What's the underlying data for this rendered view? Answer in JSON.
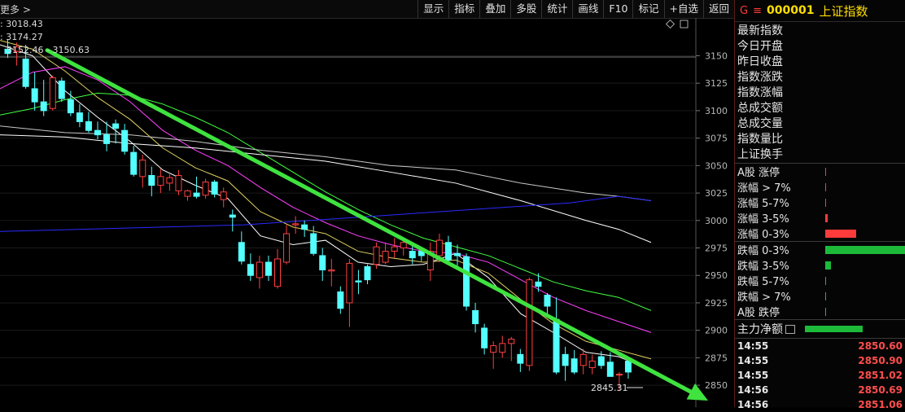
{
  "toolbar": {
    "more_label": "更多 >",
    "buttons": [
      "显示",
      "指标",
      "叠加",
      "多股",
      "统计",
      "画线",
      "F10",
      "标记",
      "+自选",
      "返回"
    ]
  },
  "chart_info": {
    "line1": ": 3018.43",
    "line2": ": 3174.27",
    "range_label": "3152.46 - 3150.63",
    "low_label": "2845.31"
  },
  "chart_icons": [
    "diamond-icon",
    "window-icon"
  ],
  "chart_data": {
    "type": "candlestick",
    "y_ticks": [
      "3150",
      "3125",
      "3100",
      "3075",
      "3050",
      "3025",
      "3000",
      "2975",
      "2950",
      "2925",
      "2900",
      "2875",
      "2850"
    ],
    "ylim": [
      2836,
      3180
    ],
    "candles": [
      [
        3156,
        3165,
        3148,
        3152
      ],
      [
        3154,
        3162,
        3141,
        3158
      ],
      [
        3147,
        3160,
        3120,
        3122
      ],
      [
        3120,
        3135,
        3100,
        3108
      ],
      [
        3108,
        3128,
        3095,
        3100
      ],
      [
        3102,
        3132,
        3100,
        3130
      ],
      [
        3127,
        3130,
        3108,
        3111
      ],
      [
        3110,
        3118,
        3095,
        3098
      ],
      [
        3098,
        3106,
        3085,
        3090
      ],
      [
        3090,
        3099,
        3080,
        3082
      ],
      [
        3082,
        3090,
        3074,
        3078
      ],
      [
        3078,
        3090,
        3063,
        3070
      ],
      [
        3088,
        3092,
        3070,
        3084
      ],
      [
        3082,
        3088,
        3060,
        3063
      ],
      [
        3062,
        3068,
        3040,
        3042
      ],
      [
        3040,
        3060,
        3030,
        3055
      ],
      [
        3041,
        3049,
        3022,
        3032
      ],
      [
        3032,
        3047,
        3025,
        3040
      ],
      [
        3034,
        3042,
        3027,
        3039
      ],
      [
        3027,
        3046,
        3023,
        3041
      ],
      [
        3022,
        3028,
        3018,
        3027
      ],
      [
        3025,
        3040,
        3020,
        3022
      ],
      [
        3023,
        3038,
        3020,
        3035
      ],
      [
        3035,
        3037,
        3021,
        3024
      ],
      [
        3019,
        3030,
        3012,
        3026
      ],
      [
        3005,
        3010,
        2990,
        3003
      ],
      [
        2980,
        2990,
        2960,
        2963
      ],
      [
        2960,
        2970,
        2945,
        2950
      ],
      [
        2948,
        2968,
        2938,
        2962
      ],
      [
        2962,
        2968,
        2945,
        2950
      ],
      [
        2940,
        2974,
        2938,
        2965
      ],
      [
        2962,
        2996,
        2960,
        2988
      ],
      [
        2996,
        3004,
        2988,
        2997
      ],
      [
        2996,
        3000,
        2985,
        2992
      ],
      [
        2988,
        2995,
        2968,
        2970
      ],
      [
        2968,
        2975,
        2945,
        2955
      ],
      [
        2954,
        2965,
        2940,
        2955
      ],
      [
        2935,
        2940,
        2915,
        2920
      ],
      [
        2925,
        2965,
        2903,
        2961
      ],
      [
        2945,
        2955,
        2933,
        2944
      ],
      [
        2958,
        2960,
        2942,
        2946
      ],
      [
        2960,
        2980,
        2956,
        2976
      ],
      [
        2962,
        2980,
        2960,
        2972
      ],
      [
        2972,
        2984,
        2966,
        2976
      ],
      [
        2975,
        2983,
        2968,
        2980
      ],
      [
        2972,
        2978,
        2960,
        2966
      ],
      [
        2972,
        2976,
        2963,
        2968
      ],
      [
        2955,
        2980,
        2945,
        2972
      ],
      [
        2968,
        2988,
        2962,
        2982
      ],
      [
        2980,
        2986,
        2960,
        2964
      ],
      [
        2970,
        2978,
        2955,
        2968
      ],
      [
        2967,
        2970,
        2918,
        2922
      ],
      [
        2918,
        2925,
        2898,
        2906
      ],
      [
        2902,
        2906,
        2878,
        2884
      ],
      [
        2880,
        2890,
        2865,
        2886
      ],
      [
        2880,
        2895,
        2875,
        2888
      ],
      [
        2888,
        2894,
        2872,
        2892
      ],
      [
        2878,
        2883,
        2862,
        2870
      ],
      [
        2868,
        2948,
        2863,
        2946
      ],
      [
        2944,
        2952,
        2935,
        2940
      ],
      [
        2932,
        2934,
        2915,
        2922
      ],
      [
        2910,
        2930,
        2860,
        2862
      ],
      [
        2878,
        2885,
        2854,
        2868
      ],
      [
        2874,
        2882,
        2860,
        2862
      ],
      [
        2868,
        2883,
        2860,
        2878
      ],
      [
        2866,
        2878,
        2860,
        2872
      ],
      [
        2876,
        2881,
        2865,
        2868
      ],
      [
        2871,
        2880,
        2860,
        2858
      ],
      [
        2860,
        2862,
        2845,
        2860
      ],
      [
        2872,
        2874,
        2856,
        2862
      ]
    ],
    "ma_series": [
      {
        "color": "#ffffff",
        "pts": [
          [
            0,
            3160
          ],
          [
            40,
            3150
          ],
          [
            80,
            3118
          ],
          [
            120,
            3094
          ],
          [
            160,
            3072
          ],
          [
            200,
            3046
          ],
          [
            240,
            3032
          ],
          [
            280,
            3020
          ],
          [
            320,
            2986
          ],
          [
            360,
            2978
          ],
          [
            400,
            2982
          ],
          [
            440,
            2962
          ],
          [
            480,
            2958
          ],
          [
            520,
            2960
          ],
          [
            560,
            2970
          ],
          [
            600,
            2948
          ],
          [
            640,
            2915
          ],
          [
            680,
            2898
          ],
          [
            720,
            2880
          ],
          [
            760,
            2876
          ],
          [
            800,
            2864
          ]
        ]
      },
      {
        "color": "#e0d060",
        "pts": [
          [
            0,
            3164
          ],
          [
            40,
            3156
          ],
          [
            80,
            3136
          ],
          [
            120,
            3112
          ],
          [
            160,
            3092
          ],
          [
            200,
            3066
          ],
          [
            240,
            3048
          ],
          [
            280,
            3036
          ],
          [
            320,
            3008
          ],
          [
            360,
            2994
          ],
          [
            400,
            2988
          ],
          [
            440,
            2972
          ],
          [
            480,
            2966
          ],
          [
            520,
            2962
          ],
          [
            560,
            2964
          ],
          [
            600,
            2952
          ],
          [
            640,
            2928
          ],
          [
            680,
            2906
          ],
          [
            720,
            2890
          ],
          [
            760,
            2882
          ],
          [
            800,
            2874
          ]
        ]
      },
      {
        "color": "#ff40ff",
        "pts": [
          [
            0,
            3120
          ],
          [
            40,
            3135
          ],
          [
            80,
            3140
          ],
          [
            120,
            3128
          ],
          [
            160,
            3108
          ],
          [
            200,
            3082
          ],
          [
            240,
            3064
          ],
          [
            280,
            3050
          ],
          [
            320,
            3030
          ],
          [
            360,
            3012
          ],
          [
            400,
            2998
          ],
          [
            440,
            2986
          ],
          [
            480,
            2978
          ],
          [
            520,
            2972
          ],
          [
            560,
            2970
          ],
          [
            600,
            2962
          ],
          [
            640,
            2946
          ],
          [
            680,
            2930
          ],
          [
            720,
            2918
          ],
          [
            760,
            2908
          ],
          [
            800,
            2898
          ]
        ]
      },
      {
        "color": "#40ff40",
        "pts": [
          [
            0,
            3096
          ],
          [
            40,
            3102
          ],
          [
            80,
            3110
          ],
          [
            120,
            3116
          ],
          [
            160,
            3114
          ],
          [
            200,
            3106
          ],
          [
            240,
            3094
          ],
          [
            280,
            3080
          ],
          [
            320,
            3062
          ],
          [
            360,
            3044
          ],
          [
            400,
            3026
          ],
          [
            440,
            3010
          ],
          [
            480,
            2996
          ],
          [
            520,
            2984
          ],
          [
            560,
            2976
          ],
          [
            600,
            2968
          ],
          [
            640,
            2956
          ],
          [
            680,
            2944
          ],
          [
            720,
            2936
          ],
          [
            760,
            2930
          ],
          [
            800,
            2918
          ]
        ]
      },
      {
        "color": "#c8c8c8",
        "pts": [
          [
            0,
            3086
          ],
          [
            80,
            3080
          ],
          [
            160,
            3078
          ],
          [
            240,
            3072
          ],
          [
            320,
            3064
          ],
          [
            400,
            3058
          ],
          [
            480,
            3050
          ],
          [
            560,
            3046
          ],
          [
            640,
            3034
          ],
          [
            720,
            3025
          ],
          [
            760,
            3022
          ],
          [
            800,
            3018
          ]
        ]
      },
      {
        "color": "#ffffff",
        "pts": [
          [
            0,
            3078
          ],
          [
            80,
            3076
          ],
          [
            160,
            3070
          ],
          [
            240,
            3066
          ],
          [
            320,
            3060
          ],
          [
            400,
            3054
          ],
          [
            480,
            3044
          ],
          [
            560,
            3034
          ],
          [
            640,
            3018
          ],
          [
            720,
            3000
          ],
          [
            760,
            2992
          ],
          [
            800,
            2980
          ]
        ]
      },
      {
        "color": "#2a2aff",
        "pts": [
          [
            0,
            2990
          ],
          [
            100,
            2992
          ],
          [
            200,
            2994
          ],
          [
            300,
            2996
          ],
          [
            400,
            3001
          ],
          [
            500,
            3006
          ],
          [
            600,
            3011
          ],
          [
            700,
            3016
          ],
          [
            760,
            3022
          ],
          [
            800,
            3018
          ]
        ]
      }
    ],
    "trend_arrow": {
      "from": [
        58,
        3155
      ],
      "to": [
        870,
        2836
      ]
    }
  },
  "panel": {
    "code_marker": "G",
    "menu_icon": "≡",
    "code": "000001",
    "name": "上证指数",
    "fields": [
      "最新指数",
      "今日开盘",
      "昨日收盘",
      "指数涨跌",
      "指数涨幅",
      "总成交额",
      "总成交量",
      "指数量比",
      "上证换手"
    ],
    "dist": [
      {
        "label": "A股 涨停",
        "color": "#ff3b3b",
        "ratio": 0.01
      },
      {
        "label": "涨幅 > 7%",
        "color": "#ff3b3b",
        "ratio": 0.01
      },
      {
        "label": "涨幅 5-7%",
        "color": "#ff3b3b",
        "ratio": 0.01
      },
      {
        "label": "涨幅 3-5%",
        "color": "#ff3b3b",
        "ratio": 0.03
      },
      {
        "label": "涨幅 0-3%",
        "color": "#ff3b3b",
        "ratio": 0.39
      },
      {
        "label": "跌幅 0-3%",
        "color": "#1dba3a",
        "ratio": 1.0
      },
      {
        "label": "跌幅 3-5%",
        "color": "#1dba3a",
        "ratio": 0.07
      },
      {
        "label": "跌幅 5-7%",
        "color": "#1dba3a",
        "ratio": 0.01
      },
      {
        "label": "跌幅 > 7%",
        "color": "#1dba3a",
        "ratio": 0.01
      },
      {
        "label": "A股 跌停",
        "color": "#1dba3a",
        "ratio": 0.01
      }
    ],
    "main_label": "主力净额",
    "main_ratio": 0.72,
    "ticks": [
      {
        "time": "14:55",
        "price": "2850.60"
      },
      {
        "time": "14:55",
        "price": "2850.90"
      },
      {
        "time": "14:55",
        "price": "2851.02"
      },
      {
        "time": "14:56",
        "price": "2850.69"
      },
      {
        "time": "14:56",
        "price": "2851.06"
      }
    ]
  }
}
